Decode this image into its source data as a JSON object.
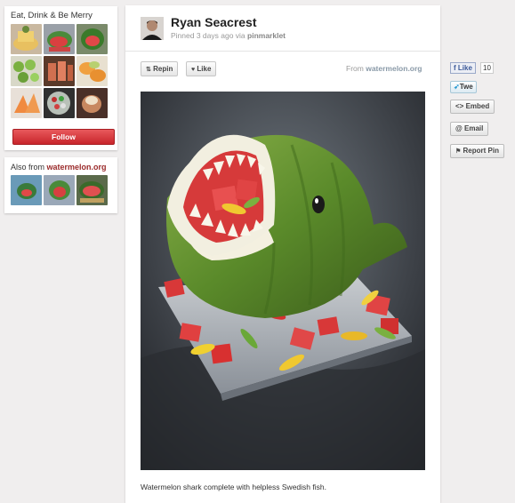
{
  "board": {
    "title": "Eat, Drink & Be Merry",
    "follow_label": "Follow",
    "thumbs": [
      "thumb-cake",
      "thumb-watermelon-shark",
      "thumb-watermelon-shark-2",
      "thumb-kiwi",
      "thumb-jars",
      "thumb-melon-bowl",
      "thumb-melon-slices",
      "thumb-salad",
      "thumb-dessert"
    ]
  },
  "also_from": {
    "prefix": "Also from ",
    "source": "watermelon.org"
  },
  "pin": {
    "pinner_name": "Ryan Seacrest",
    "pinned_text": "Pinned 3 days ago via ",
    "via": "pinmarklet",
    "repin_label": "Repin",
    "like_label": "Like",
    "from_prefix": "From ",
    "from_source": "watermelon.org",
    "caption": "Watermelon shark complete with helpless Swedish fish."
  },
  "side": {
    "fb_like_label": "Like",
    "fb_count": "10",
    "tweet_label": "Twe",
    "embed_label": "<> Embed",
    "email_label": "@ Email",
    "report_label": "Report Pin"
  },
  "colors": {
    "follow": "#d0343a",
    "background": "#f0eeee",
    "accent_link": "#9a2a2a"
  }
}
